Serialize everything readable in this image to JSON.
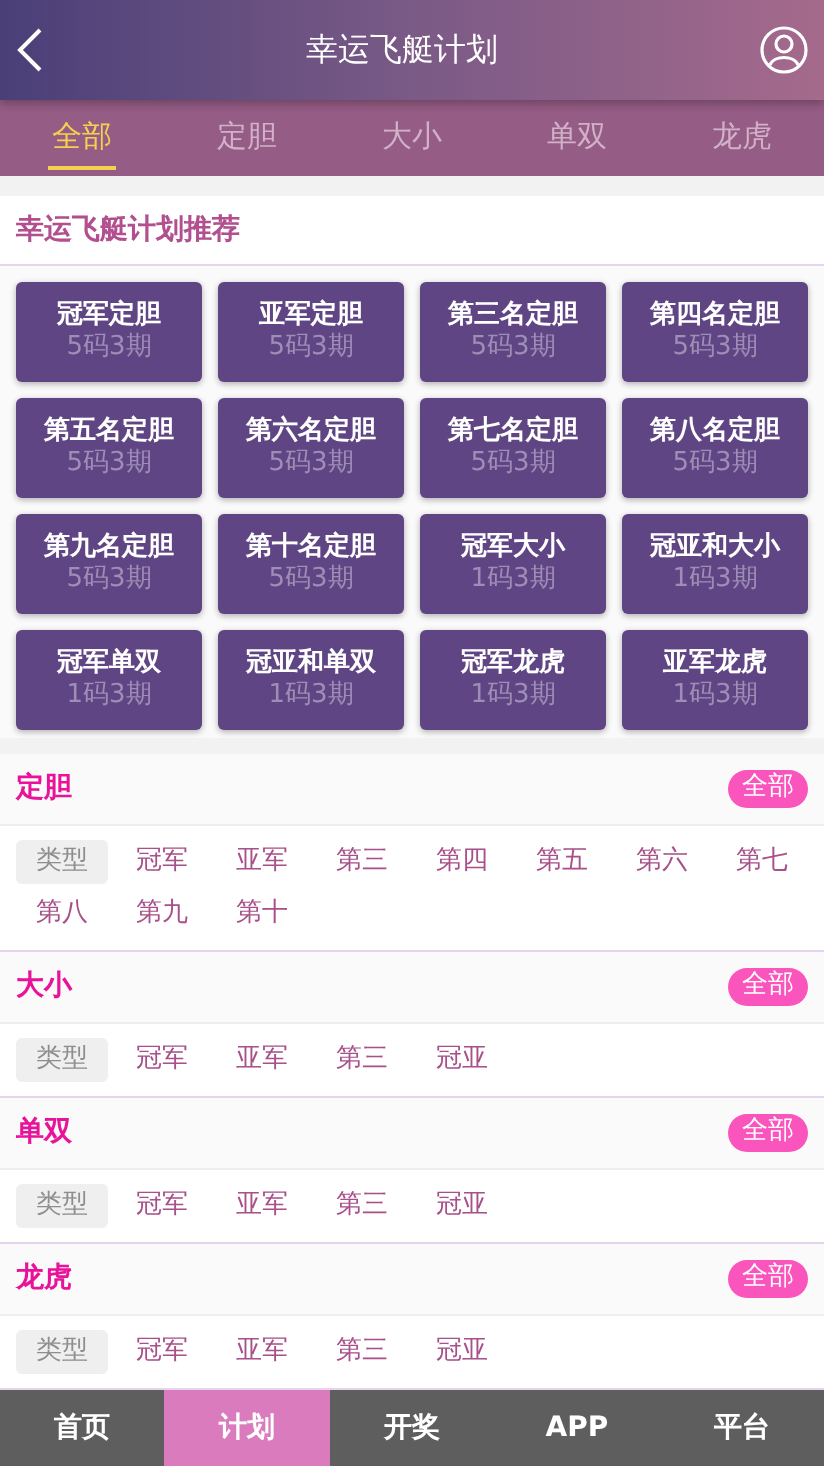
{
  "header": {
    "title": "幸运飞艇计划"
  },
  "tabs": [
    {
      "label": "全部",
      "selected": true
    },
    {
      "label": "定胆",
      "selected": false
    },
    {
      "label": "大小",
      "selected": false
    },
    {
      "label": "单双",
      "selected": false
    },
    {
      "label": "龙虎",
      "selected": false
    }
  ],
  "recommend": {
    "title": "幸运飞艇计划推荐",
    "plans": [
      {
        "name": "冠军定胆",
        "detail": "5码3期"
      },
      {
        "name": "亚军定胆",
        "detail": "5码3期"
      },
      {
        "name": "第三名定胆",
        "detail": "5码3期"
      },
      {
        "name": "第四名定胆",
        "detail": "5码3期"
      },
      {
        "name": "第五名定胆",
        "detail": "5码3期"
      },
      {
        "name": "第六名定胆",
        "detail": "5码3期"
      },
      {
        "name": "第七名定胆",
        "detail": "5码3期"
      },
      {
        "name": "第八名定胆",
        "detail": "5码3期"
      },
      {
        "name": "第九名定胆",
        "detail": "5码3期"
      },
      {
        "name": "第十名定胆",
        "detail": "5码3期"
      },
      {
        "name": "冠军大小",
        "detail": "1码3期"
      },
      {
        "name": "冠亚和大小",
        "detail": "1码3期"
      },
      {
        "name": "冠军单双",
        "detail": "1码3期"
      },
      {
        "name": "冠亚和单双",
        "detail": "1码3期"
      },
      {
        "name": "冠军龙虎",
        "detail": "1码3期"
      },
      {
        "name": "亚军龙虎",
        "detail": "1码3期"
      }
    ]
  },
  "sections": [
    {
      "title": "定胆",
      "all_button": "全部",
      "type_label": "类型",
      "items": [
        "冠军",
        "亚军",
        "第三",
        "第四",
        "第五",
        "第六",
        "第七",
        "第八",
        "第九",
        "第十"
      ]
    },
    {
      "title": "大小",
      "all_button": "全部",
      "type_label": "类型",
      "items": [
        "冠军",
        "亚军",
        "第三",
        "冠亚"
      ]
    },
    {
      "title": "单双",
      "all_button": "全部",
      "type_label": "类型",
      "items": [
        "冠军",
        "亚军",
        "第三",
        "冠亚"
      ]
    },
    {
      "title": "龙虎",
      "all_button": "全部",
      "type_label": "类型",
      "items": [
        "冠军",
        "亚军",
        "第三",
        "冠亚"
      ]
    }
  ],
  "bottom_nav": [
    {
      "label": "首页",
      "selected": false
    },
    {
      "label": "计划",
      "selected": true
    },
    {
      "label": "开奖",
      "selected": false
    },
    {
      "label": "APP",
      "selected": false
    },
    {
      "label": "平台",
      "selected": false
    }
  ]
}
